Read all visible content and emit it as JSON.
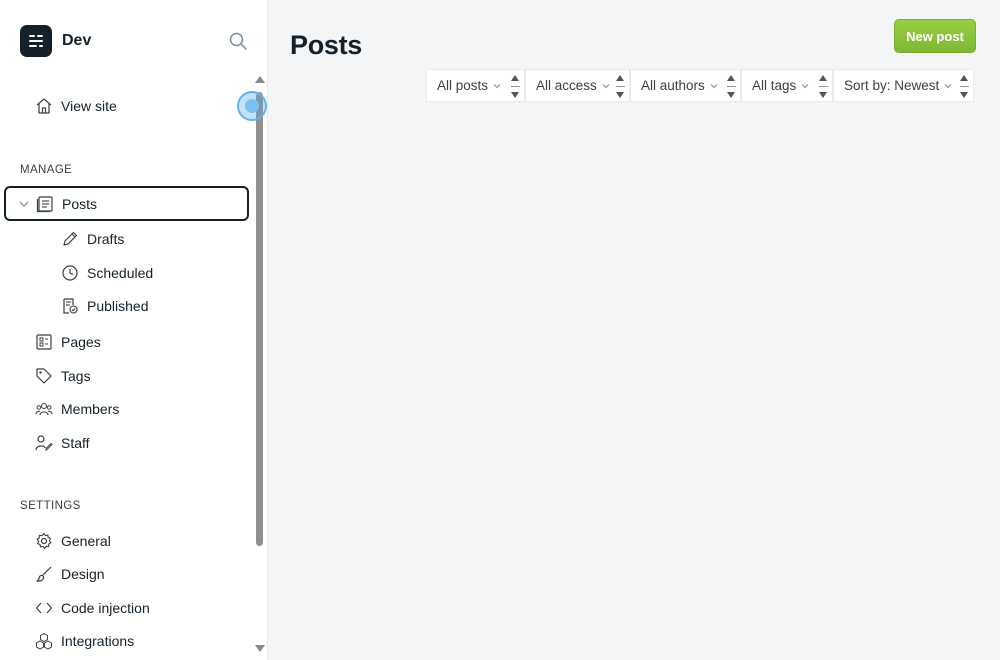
{
  "brand": {
    "name": "Dev",
    "logo_icon": "ghost-logo-icon"
  },
  "sidebar": {
    "view_site": "View site",
    "manage_label": "MANAGE",
    "posts": "Posts",
    "drafts": "Drafts",
    "scheduled": "Scheduled",
    "published": "Published",
    "pages": "Pages",
    "tags": "Tags",
    "members": "Members",
    "staff": "Staff",
    "settings_label": "SETTINGS",
    "general": "General",
    "design": "Design",
    "code_injection": "Code injection",
    "integrations": "Integrations"
  },
  "main": {
    "title": "Posts",
    "new_post": "New post",
    "filters": {
      "type": "All posts",
      "access": "All access",
      "authors": "All authors",
      "tags": "All tags",
      "sort": "Sort by: Newest"
    }
  },
  "colors": {
    "accent": "#8dc63f",
    "text": "#15212a",
    "background": "#f4f5f6"
  }
}
